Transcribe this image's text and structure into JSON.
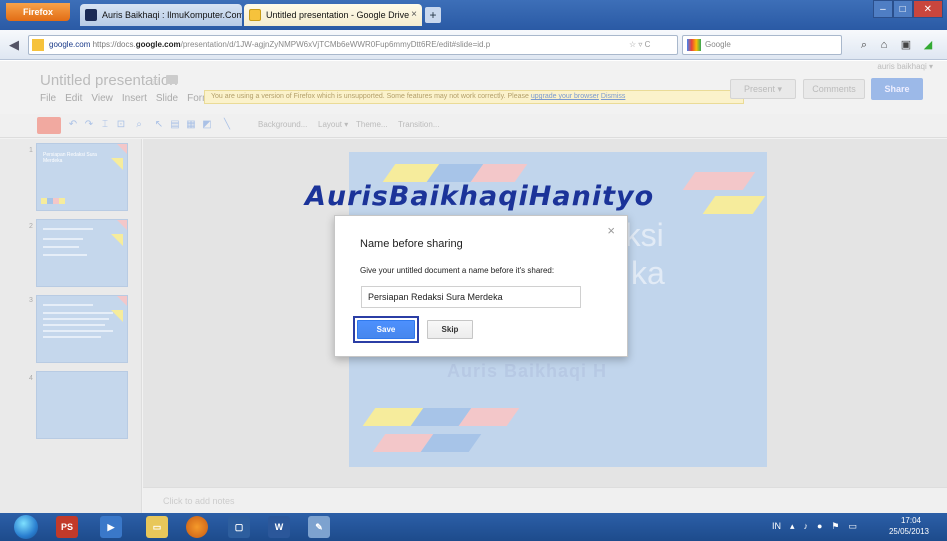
{
  "browser": {
    "menu_button": "Firefox",
    "tabs": [
      {
        "label": "Auris Baikhaqi : IlmuKomputer.Com",
        "close": "×"
      },
      {
        "label": "Untitled presentation - Google Drive",
        "close": "×"
      }
    ],
    "new_tab": "+",
    "url_domain": "google.com",
    "url_prefix": "https://docs.",
    "url_path": "/presentation/d/1JW-agjnZyNMPW6xVjTCMb6eWWR0Fup6mmyDtt6RE/edit#slide=id.p",
    "search_placeholder": "Google"
  },
  "app": {
    "doc_title": "Untitled presentation",
    "menu": [
      "File",
      "Edit",
      "View",
      "Insert",
      "Slide",
      "Form"
    ],
    "user_email": "auris baikhaqi ▾",
    "present_label": "Present",
    "comments_label": "Comments",
    "share_label": "Share",
    "warning_text": "You are using a version of Firefox which is unsupported. Some features may not work correctly. Please",
    "warning_link1": "upgrade your browser",
    "warning_link2": "Dismiss",
    "toolbar_menus": [
      "Background...",
      "Layout ▾",
      "Theme...",
      "Transition..."
    ],
    "notes_placeholder": "Click to add notes"
  },
  "filmstrip": {
    "slides": [
      {
        "num": "1",
        "title": "Persiapan Redaksi Sura Merdeka"
      },
      {
        "num": "2",
        "title": ""
      },
      {
        "num": "3",
        "title": ""
      },
      {
        "num": "4",
        "title": ""
      }
    ]
  },
  "slide": {
    "title_line1": "daksi",
    "title_line2": "ka",
    "subtitle": "Auris Baikhaqi H"
  },
  "watermark": "AurisBaikhaqiHanityo",
  "dialog": {
    "title": "Name before sharing",
    "close": "×",
    "description": "Give your untitled document a name before it's shared:",
    "input_value": "Persiapan Redaksi Sura Merdeka",
    "save_label": "Save",
    "skip_label": "Skip"
  },
  "taskbar": {
    "time": "17:04",
    "date": "25/05/2013",
    "lang": "IN"
  },
  "colors": {
    "save_blue": "#4d90fe",
    "highlight": "#2b3ea5",
    "watermark": "#1b3399"
  }
}
